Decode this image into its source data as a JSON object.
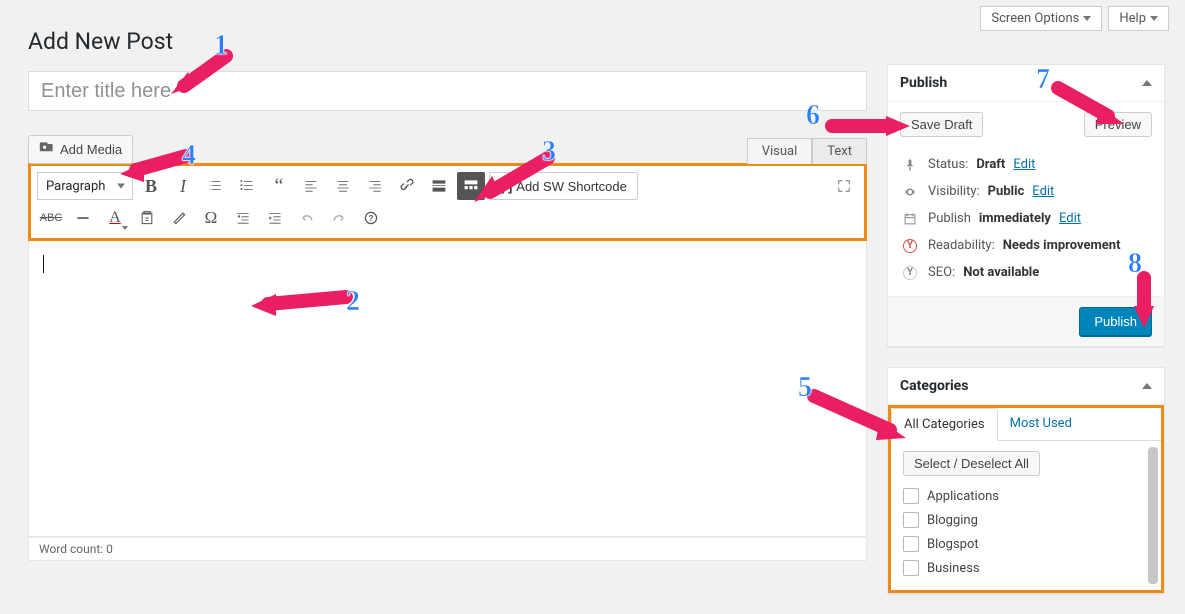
{
  "screen_meta": {
    "screen_options": "Screen Options",
    "help": "Help"
  },
  "heading": "Add New Post",
  "title_placeholder": "Enter title here",
  "add_media_label": "Add Media",
  "editor_tabs": {
    "visual": "Visual",
    "text": "Text"
  },
  "format_select": "Paragraph",
  "shortcode_btn": "Add SW Shortcode",
  "word_count_label": "Word count: 0",
  "publish_box": {
    "title": "Publish",
    "save_draft": "Save Draft",
    "preview": "Preview",
    "status_label": "Status:",
    "status_value": "Draft",
    "visibility_label": "Visibility:",
    "visibility_value": "Public",
    "publish_label": "Publish",
    "publish_value": "immediately",
    "readability_label": "Readability:",
    "readability_value": "Needs improvement",
    "seo_label": "SEO:",
    "seo_value": "Not available",
    "edit": "Edit",
    "publish_btn": "Publish"
  },
  "categories_box": {
    "title": "Categories",
    "tab_all": "All Categories",
    "tab_most": "Most Used",
    "select_all": "Select / Deselect All",
    "items": {
      "0": "Applications",
      "1": "Blogging",
      "2": "Blogspot",
      "3": "Business"
    }
  },
  "annotations": {
    "1": "1",
    "2": "2",
    "3": "3",
    "4": "4",
    "5": "5",
    "6": "6",
    "7": "7",
    "8": "8"
  }
}
